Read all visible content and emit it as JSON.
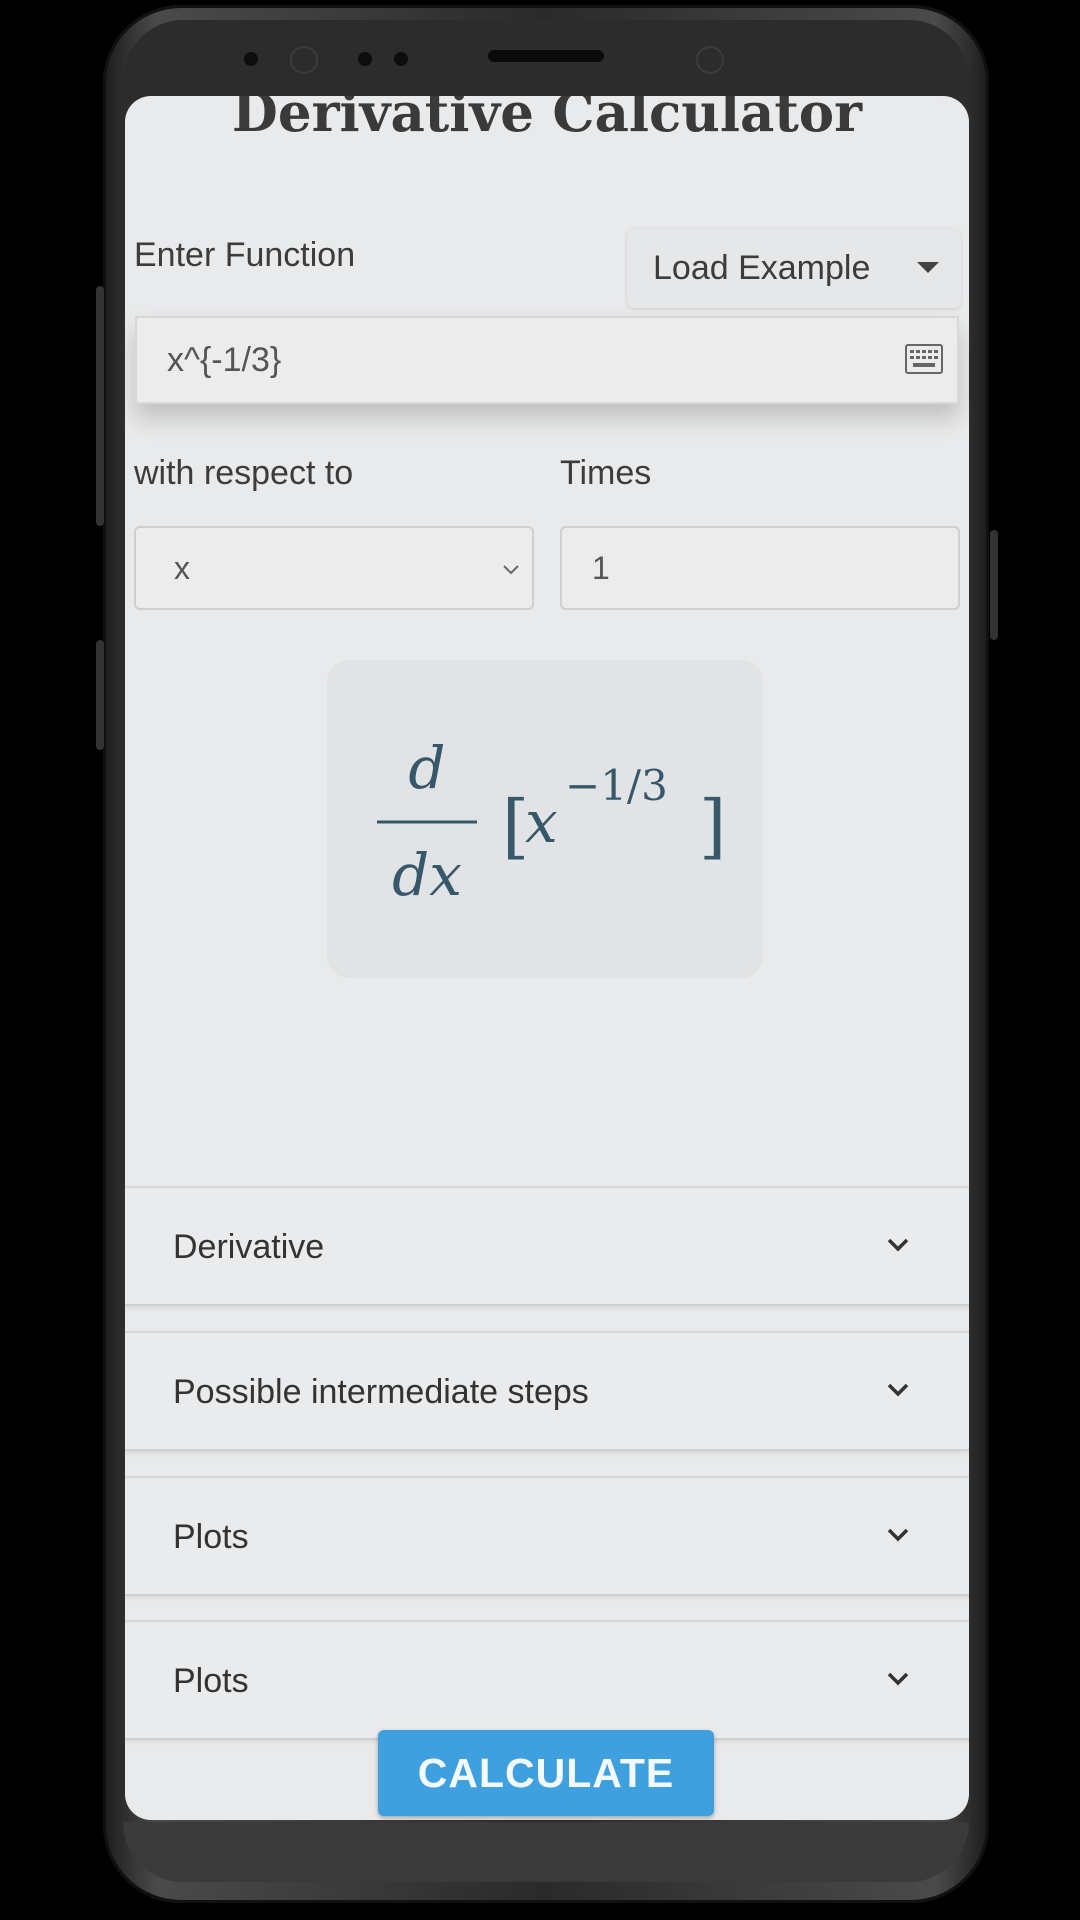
{
  "app": {
    "title": "Derivative Calculator"
  },
  "function_section": {
    "label": "Enter Function",
    "load_example": "Load Example",
    "input_value": "x^{-1/3}"
  },
  "respect": {
    "label": "with respect to",
    "value": "x"
  },
  "times": {
    "label": "Times",
    "value": "1"
  },
  "preview": {
    "numerator": "d",
    "denominator": "dx",
    "open_bracket": "[",
    "base": "x",
    "exponent": "−1/3",
    "close_bracket": "]"
  },
  "accordions": [
    {
      "label": "Derivative"
    },
    {
      "label": "Possible intermediate steps"
    },
    {
      "label": "Plots"
    },
    {
      "label": "Plots"
    }
  ],
  "calculate": {
    "label": "CALCULATE"
  },
  "colors": {
    "accent": "#3fa0e0",
    "math": "#37586a"
  }
}
